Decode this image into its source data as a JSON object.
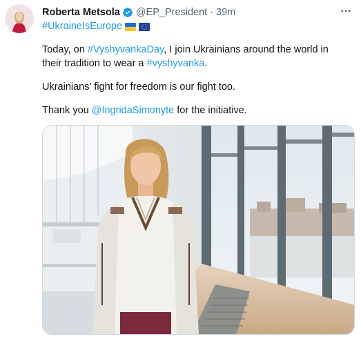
{
  "tweet": {
    "author_name": "Roberta Metsola",
    "handle": "@EP_President",
    "separator": "·",
    "time": "39m",
    "hashtag_line": "#UkraineIsEurope",
    "para1_before": "Today, on ",
    "para1_hashtag1": "#VyshyvankaDay",
    "para1_middle": ", I join Ukrainians around the world in their tradition to wear a ",
    "para1_hashtag2": "#vyshyvanka",
    "para1_end": ".",
    "para2": "Ukrainians' fight for freedom is our fight too.",
    "para3_before": "Thank you ",
    "para3_mention": "@IngridaSimonyte",
    "para3_after": " for the initiative."
  },
  "icons": {
    "verified": "verified-badge-icon",
    "more": "more-options-icon",
    "flag_ukraine": "ukraine-flag-icon",
    "flag_eu": "eu-flag-icon"
  },
  "colors": {
    "link": "#1d9bf0",
    "secondary_text": "#536471",
    "primary_text": "#0f1419",
    "verified": "#1d9bf0"
  }
}
